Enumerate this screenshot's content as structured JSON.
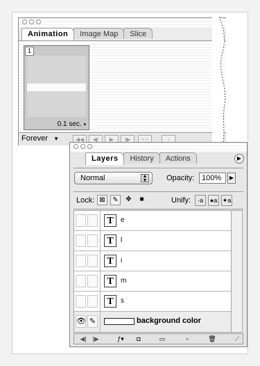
{
  "animation_palette": {
    "tabs": [
      "Animation",
      "Image Map",
      "Slice"
    ],
    "frame": {
      "number": "1",
      "delay": "0.1 sec."
    },
    "loop_option": "Forever",
    "controls": [
      "first-frame-icon",
      "previous-frame-icon",
      "play-icon",
      "next-frame-icon",
      "tween-icon",
      "new-frame-icon"
    ]
  },
  "layers_palette": {
    "tabs": [
      "Layers",
      "History",
      "Actions"
    ],
    "blend_mode": "Normal",
    "opacity_label": "Opacity:",
    "opacity_value": "100%",
    "lock_label": "Lock:",
    "unify_label": "Unify:",
    "layers": [
      {
        "type": "text",
        "thumb": "T",
        "name": "e"
      },
      {
        "type": "text",
        "thumb": "T",
        "name": "l"
      },
      {
        "type": "text",
        "thumb": "T",
        "name": "i"
      },
      {
        "type": "text",
        "thumb": "T",
        "name": "m"
      },
      {
        "type": "text",
        "thumb": "T",
        "name": "s"
      }
    ],
    "background_layer": {
      "name": "background color",
      "visible": true
    },
    "bottom_buttons": [
      "previous-frame-icon",
      "next-frame-icon",
      "layer-style-icon",
      "add-mask-icon",
      "new-set-icon",
      "new-layer-icon",
      "trash-icon"
    ]
  }
}
